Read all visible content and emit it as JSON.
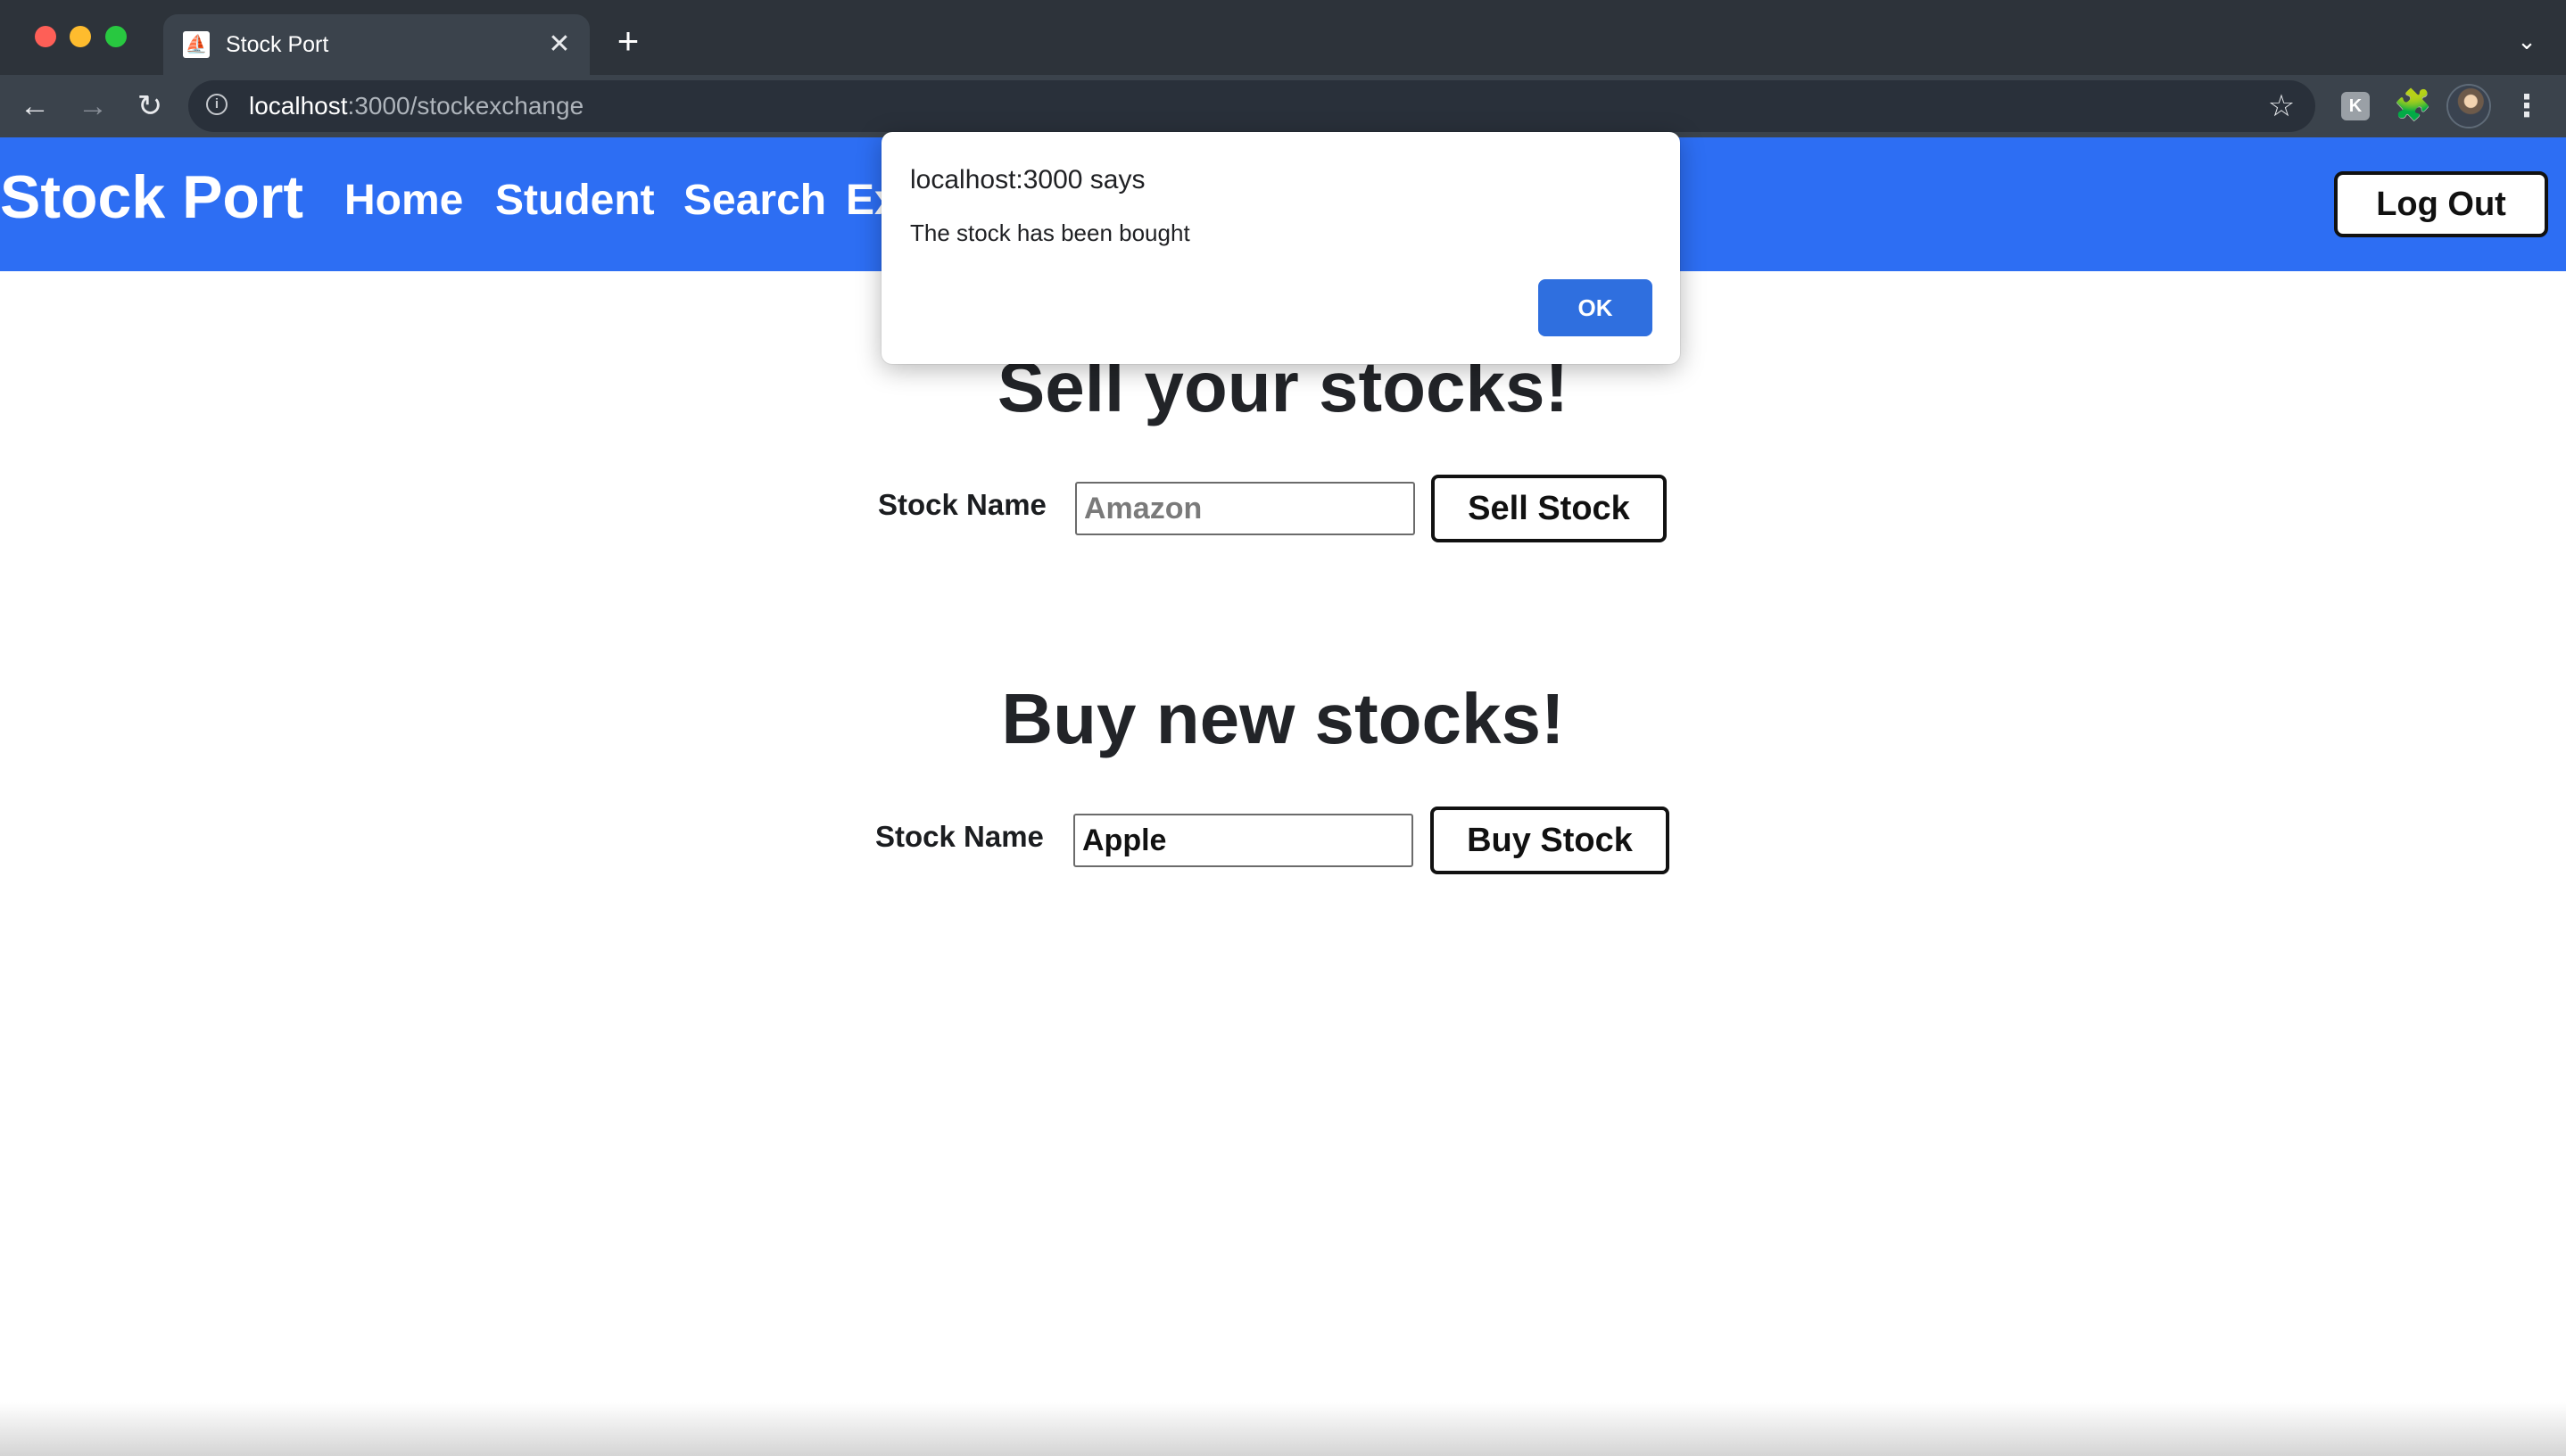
{
  "browser": {
    "tab": {
      "title": "Stock Port",
      "close_glyph": "✕"
    },
    "new_tab_glyph": "+",
    "tab_list_glyph": "⌄",
    "url": {
      "host": "localhost",
      "path": ":3000/stockexchange"
    },
    "icons": {
      "back": "back-arrow-icon",
      "forward": "forward-arrow-icon",
      "reload": "reload-icon",
      "info": "info-icon",
      "bookmark": "star-icon",
      "extension": "k-extension-icon",
      "extensions_menu": "puzzle-icon",
      "profile": "avatar",
      "menu": "kebab-menu-icon"
    },
    "glyphs": {
      "back": "←",
      "forward": "→",
      "reload": "↻",
      "info": "i",
      "star": "☆",
      "extension": "K",
      "puzzle": "🧩",
      "menu": "⋮"
    }
  },
  "app": {
    "brand": "Stock Port",
    "nav": {
      "home": "Home",
      "student": "Student",
      "search": "Search",
      "exchange_partial": "Ex"
    },
    "logout_label": "Log Out",
    "accent_color": "#2d6ef3"
  },
  "sell": {
    "title": "Sell your stocks!",
    "label": "Stock Name",
    "input_value": "",
    "input_placeholder": "Amazon",
    "button_label": "Sell Stock"
  },
  "buy": {
    "title": "Buy new stocks!",
    "label": "Stock Name",
    "input_value": "Apple",
    "input_placeholder": "",
    "button_label": "Buy Stock"
  },
  "dialog": {
    "title": "localhost:3000 says",
    "message": "The stock has been bought",
    "ok_label": "OK",
    "ok_color": "#2f6fdf"
  }
}
